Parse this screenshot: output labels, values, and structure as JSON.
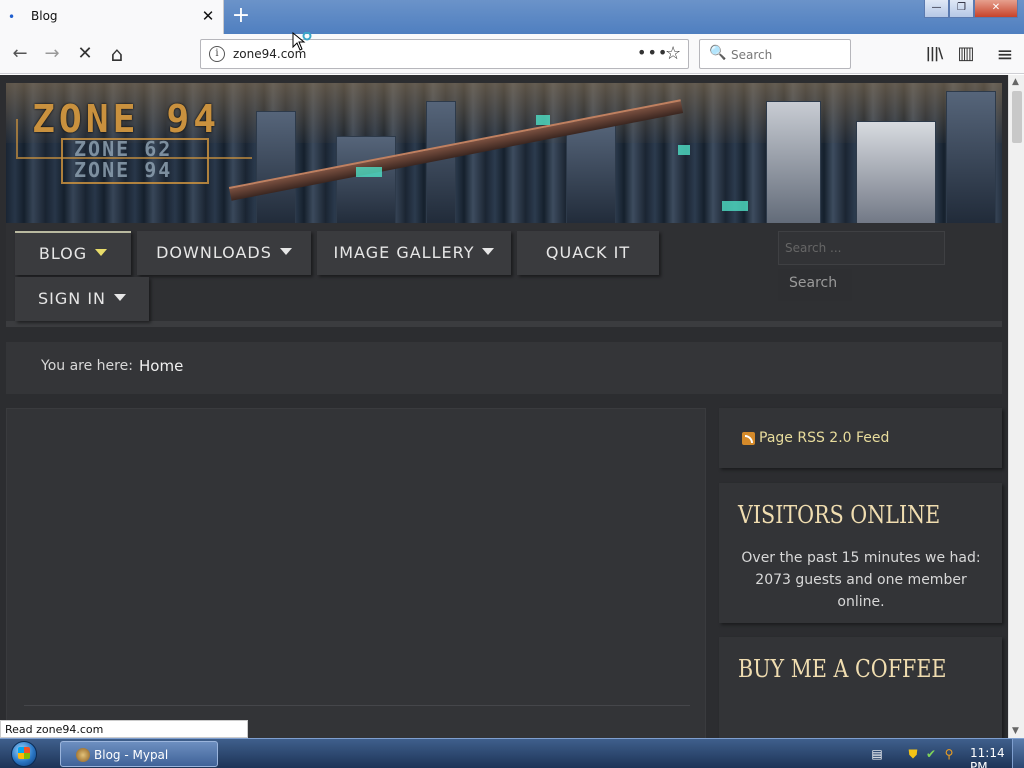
{
  "browser": {
    "tab_title": "Blog",
    "tab_close": "✕",
    "new_tab": "+",
    "url": "zone94.com",
    "search_placeholder": "Search",
    "page_actions": "•••",
    "bookmark_star": "☆",
    "window_buttons": {
      "minimize": "—",
      "restore": "❐",
      "close": "✕"
    }
  },
  "site": {
    "logo_main": "ZONE 94",
    "logo_sub1": "ZONE 62",
    "logo_sub2": "ZONE 94",
    "menu": [
      {
        "label": "BLOG",
        "dropdown": true,
        "active": true
      },
      {
        "label": "DOWNLOADS",
        "dropdown": true
      },
      {
        "label": "IMAGE GALLERY",
        "dropdown": true
      },
      {
        "label": "QUACK IT",
        "dropdown": false
      },
      {
        "label": "SIGN IN",
        "dropdown": true
      }
    ],
    "search_placeholder": "Search ...",
    "search_button": "Search",
    "breadcrumb": {
      "label": "You are here:",
      "current": "Home"
    },
    "rss_link": "Page RSS 2.0 Feed",
    "visitors": {
      "title": "VISITORS ONLINE",
      "body": "Over the past 15 minutes we had: 2073 guests and one member online."
    },
    "coffee": {
      "title": "BUY ME A COFFEE"
    }
  },
  "status_text": "Read zone94.com",
  "taskbar": {
    "item_label": "Blog - Mypal",
    "clock": "11:14 PM"
  },
  "icons": {
    "back": "←",
    "forward": "→",
    "stop": "✕",
    "home": "⌂",
    "library": "|||\\",
    "sidebar": "▥",
    "menu": "≡"
  },
  "colors": {
    "accent_gold": "#c9913e",
    "heading": "#f0ddb0",
    "rss_text": "#e8dc9c",
    "page_bg": "#2c2d30"
  }
}
